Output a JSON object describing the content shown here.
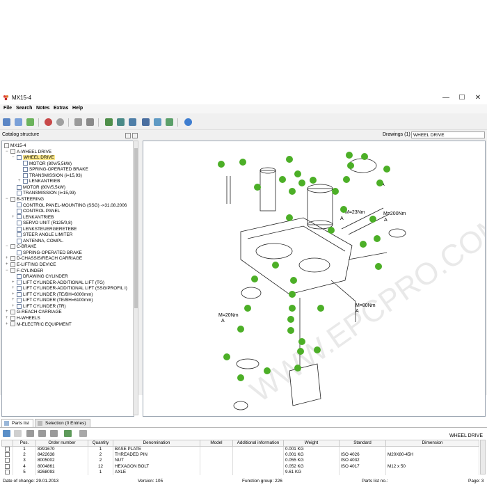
{
  "window": {
    "title": "MX15-4",
    "minimize": "—",
    "maximize": "☐",
    "close": "✕"
  },
  "menu": [
    "File",
    "Search",
    "Notes",
    "Extras",
    "Help"
  ],
  "catalog": {
    "header": "Catalog structure",
    "nodes": [
      {
        "label": "MX15-4",
        "depth": 0,
        "expander": "",
        "icon": "folder-icon",
        "selected": false
      },
      {
        "label": "A-WHEEL DRIVE",
        "depth": 1,
        "expander": "−",
        "icon": "folder-icon",
        "selected": false
      },
      {
        "label": "WHEEL DRIVE",
        "depth": 2,
        "expander": "−",
        "icon": "doc-icon",
        "selected": true
      },
      {
        "label": "MOTOR (80V/5,5kW)",
        "depth": 3,
        "expander": "",
        "icon": "doc-icon",
        "selected": false
      },
      {
        "label": "SPRING-OPERATED BRAKE",
        "depth": 3,
        "expander": "",
        "icon": "doc-icon",
        "selected": false
      },
      {
        "label": "TRANSMISSION (i=15,93)",
        "depth": 3,
        "expander": "",
        "icon": "doc-icon",
        "selected": false
      },
      {
        "label": "LENKANTRIEB",
        "depth": 3,
        "expander": "+",
        "icon": "doc-icon",
        "selected": false
      },
      {
        "label": "MOTOR (80V/5,5kW)",
        "depth": 2,
        "expander": "",
        "icon": "doc-icon",
        "selected": false
      },
      {
        "label": "TRANSMISSION (i=15,93)",
        "depth": 2,
        "expander": "",
        "icon": "doc-icon",
        "selected": false
      },
      {
        "label": "B-STEERING",
        "depth": 1,
        "expander": "−",
        "icon": "folder-icon",
        "selected": false
      },
      {
        "label": "CONTROL PANEL-MOUNTING (SSG) -&gt;31.08.2006",
        "depth": 2,
        "expander": "",
        "icon": "doc-icon",
        "selected": false
      },
      {
        "label": "CONTROL PANEL",
        "depth": 2,
        "expander": "",
        "icon": "doc-icon",
        "selected": false
      },
      {
        "label": "LENKANTRIEB",
        "depth": 2,
        "expander": "+",
        "icon": "doc-icon",
        "selected": false
      },
      {
        "label": "SERVO UNIT (R125/0,8)",
        "depth": 2,
        "expander": "",
        "icon": "doc-icon",
        "selected": false
      },
      {
        "label": "LENKSTEUERGERETEBE",
        "depth": 2,
        "expander": "",
        "icon": "doc-icon",
        "selected": false
      },
      {
        "label": "STEER ANGLE LIMITER",
        "depth": 2,
        "expander": "",
        "icon": "doc-icon",
        "selected": false
      },
      {
        "label": "ANTENNA, COMPL.",
        "depth": 2,
        "expander": "",
        "icon": "doc-icon",
        "selected": false
      },
      {
        "label": "C-BRAKE",
        "depth": 1,
        "expander": "−",
        "icon": "folder-icon",
        "selected": false
      },
      {
        "label": "SPRING-OPERATED BRAKE",
        "depth": 2,
        "expander": "",
        "icon": "doc-icon",
        "selected": false
      },
      {
        "label": "D-CHASSIS/REACH CARRIAGE",
        "depth": 1,
        "expander": "+",
        "icon": "folder-icon",
        "selected": false
      },
      {
        "label": "E-LIFTING DEVICE",
        "depth": 1,
        "expander": "+",
        "icon": "folder-icon",
        "selected": false
      },
      {
        "label": "F-CYLINDER",
        "depth": 1,
        "expander": "−",
        "icon": "folder-icon",
        "selected": false
      },
      {
        "label": "DRAWING CYLINDER",
        "depth": 2,
        "expander": "",
        "icon": "doc-icon",
        "selected": false
      },
      {
        "label": "LIFT CYLINDER-ADDITIONAL LIFT (TG)",
        "depth": 2,
        "expander": "+",
        "icon": "doc-icon",
        "selected": false
      },
      {
        "label": "LIFT CYLINDER-ADDITIONAL LIFT (SSG/PROFIL I)",
        "depth": 2,
        "expander": "+",
        "icon": "doc-icon",
        "selected": false
      },
      {
        "label": "LIFT CYLINDER (TE/BH=6000mm)",
        "depth": 2,
        "expander": "+",
        "icon": "doc-icon",
        "selected": false
      },
      {
        "label": "LIFT CYLINDER (TE/BH=6100mm)",
        "depth": 2,
        "expander": "+",
        "icon": "doc-icon",
        "selected": false
      },
      {
        "label": "LIFT CYLINDER (TR)",
        "depth": 2,
        "expander": "+",
        "icon": "doc-icon",
        "selected": false
      },
      {
        "label": "G-REACH CARRIAGE",
        "depth": 1,
        "expander": "+",
        "icon": "folder-icon",
        "selected": false
      },
      {
        "label": "H-WHEELS",
        "depth": 1,
        "expander": "+",
        "icon": "folder-icon",
        "selected": false
      },
      {
        "label": "M-ELECTRIC EQUIPMENT",
        "depth": 1,
        "expander": "+",
        "icon": "folder-icon",
        "selected": false
      }
    ]
  },
  "drawings": {
    "label": "Drawings (1)",
    "selected": "WHEEL DRIVE",
    "callouts": [
      "M=23Nm",
      "M=200Nm",
      "M=80Nm",
      "M=20Nm",
      "A",
      "A",
      "A",
      "A",
      "A"
    ],
    "watermark": "WWW.EPCPRO.COM"
  },
  "tabs": [
    {
      "label": "Parts list",
      "active": true
    },
    {
      "label": "Selection (0 Entries)",
      "active": false
    }
  ],
  "parts": {
    "caption": "WHEEL DRIVE",
    "columns": [
      "Pos.",
      "Order number",
      "Quantity",
      "Denomination",
      "Model",
      "Additional information",
      "Weight",
      "Standard",
      "Dimension"
    ],
    "rows": [
      {
        "pos": "1",
        "order": "8391670",
        "qty": "1",
        "name": "BASE PLATE",
        "model": "",
        "info": "",
        "weight": "0.001 KG",
        "standard": "",
        "dimension": ""
      },
      {
        "pos": "2",
        "order": "8422638",
        "qty": "2",
        "name": "THREADED PIN",
        "model": "",
        "info": "",
        "weight": "0.001 KG",
        "standard": "ISO 4026",
        "dimension": "M20X80-45H"
      },
      {
        "pos": "3",
        "order": "8005002",
        "qty": "2",
        "name": "NUT",
        "model": "",
        "info": "",
        "weight": "0.055 KG",
        "standard": "ISO 4032",
        "dimension": ""
      },
      {
        "pos": "4",
        "order": "8004861",
        "qty": "12",
        "name": "HEXAGON BOLT",
        "model": "",
        "info": "",
        "weight": "0.052 KG",
        "standard": "ISO 4017",
        "dimension": "M12 x 50"
      },
      {
        "pos": "5",
        "order": "8268093",
        "qty": "1",
        "name": "AXLE",
        "model": "",
        "info": "",
        "weight": "9.61 KG",
        "standard": "",
        "dimension": ""
      }
    ]
  },
  "status": {
    "date": "Date of change: 29.01.2013",
    "version": "Version: 105",
    "group": "Function group: 226",
    "partslist": "Parts list no.:",
    "page": "Page: 3"
  },
  "colors": {
    "callout": "#4caf27",
    "selection": "#fce98c",
    "frame": "#9aa4b0"
  }
}
